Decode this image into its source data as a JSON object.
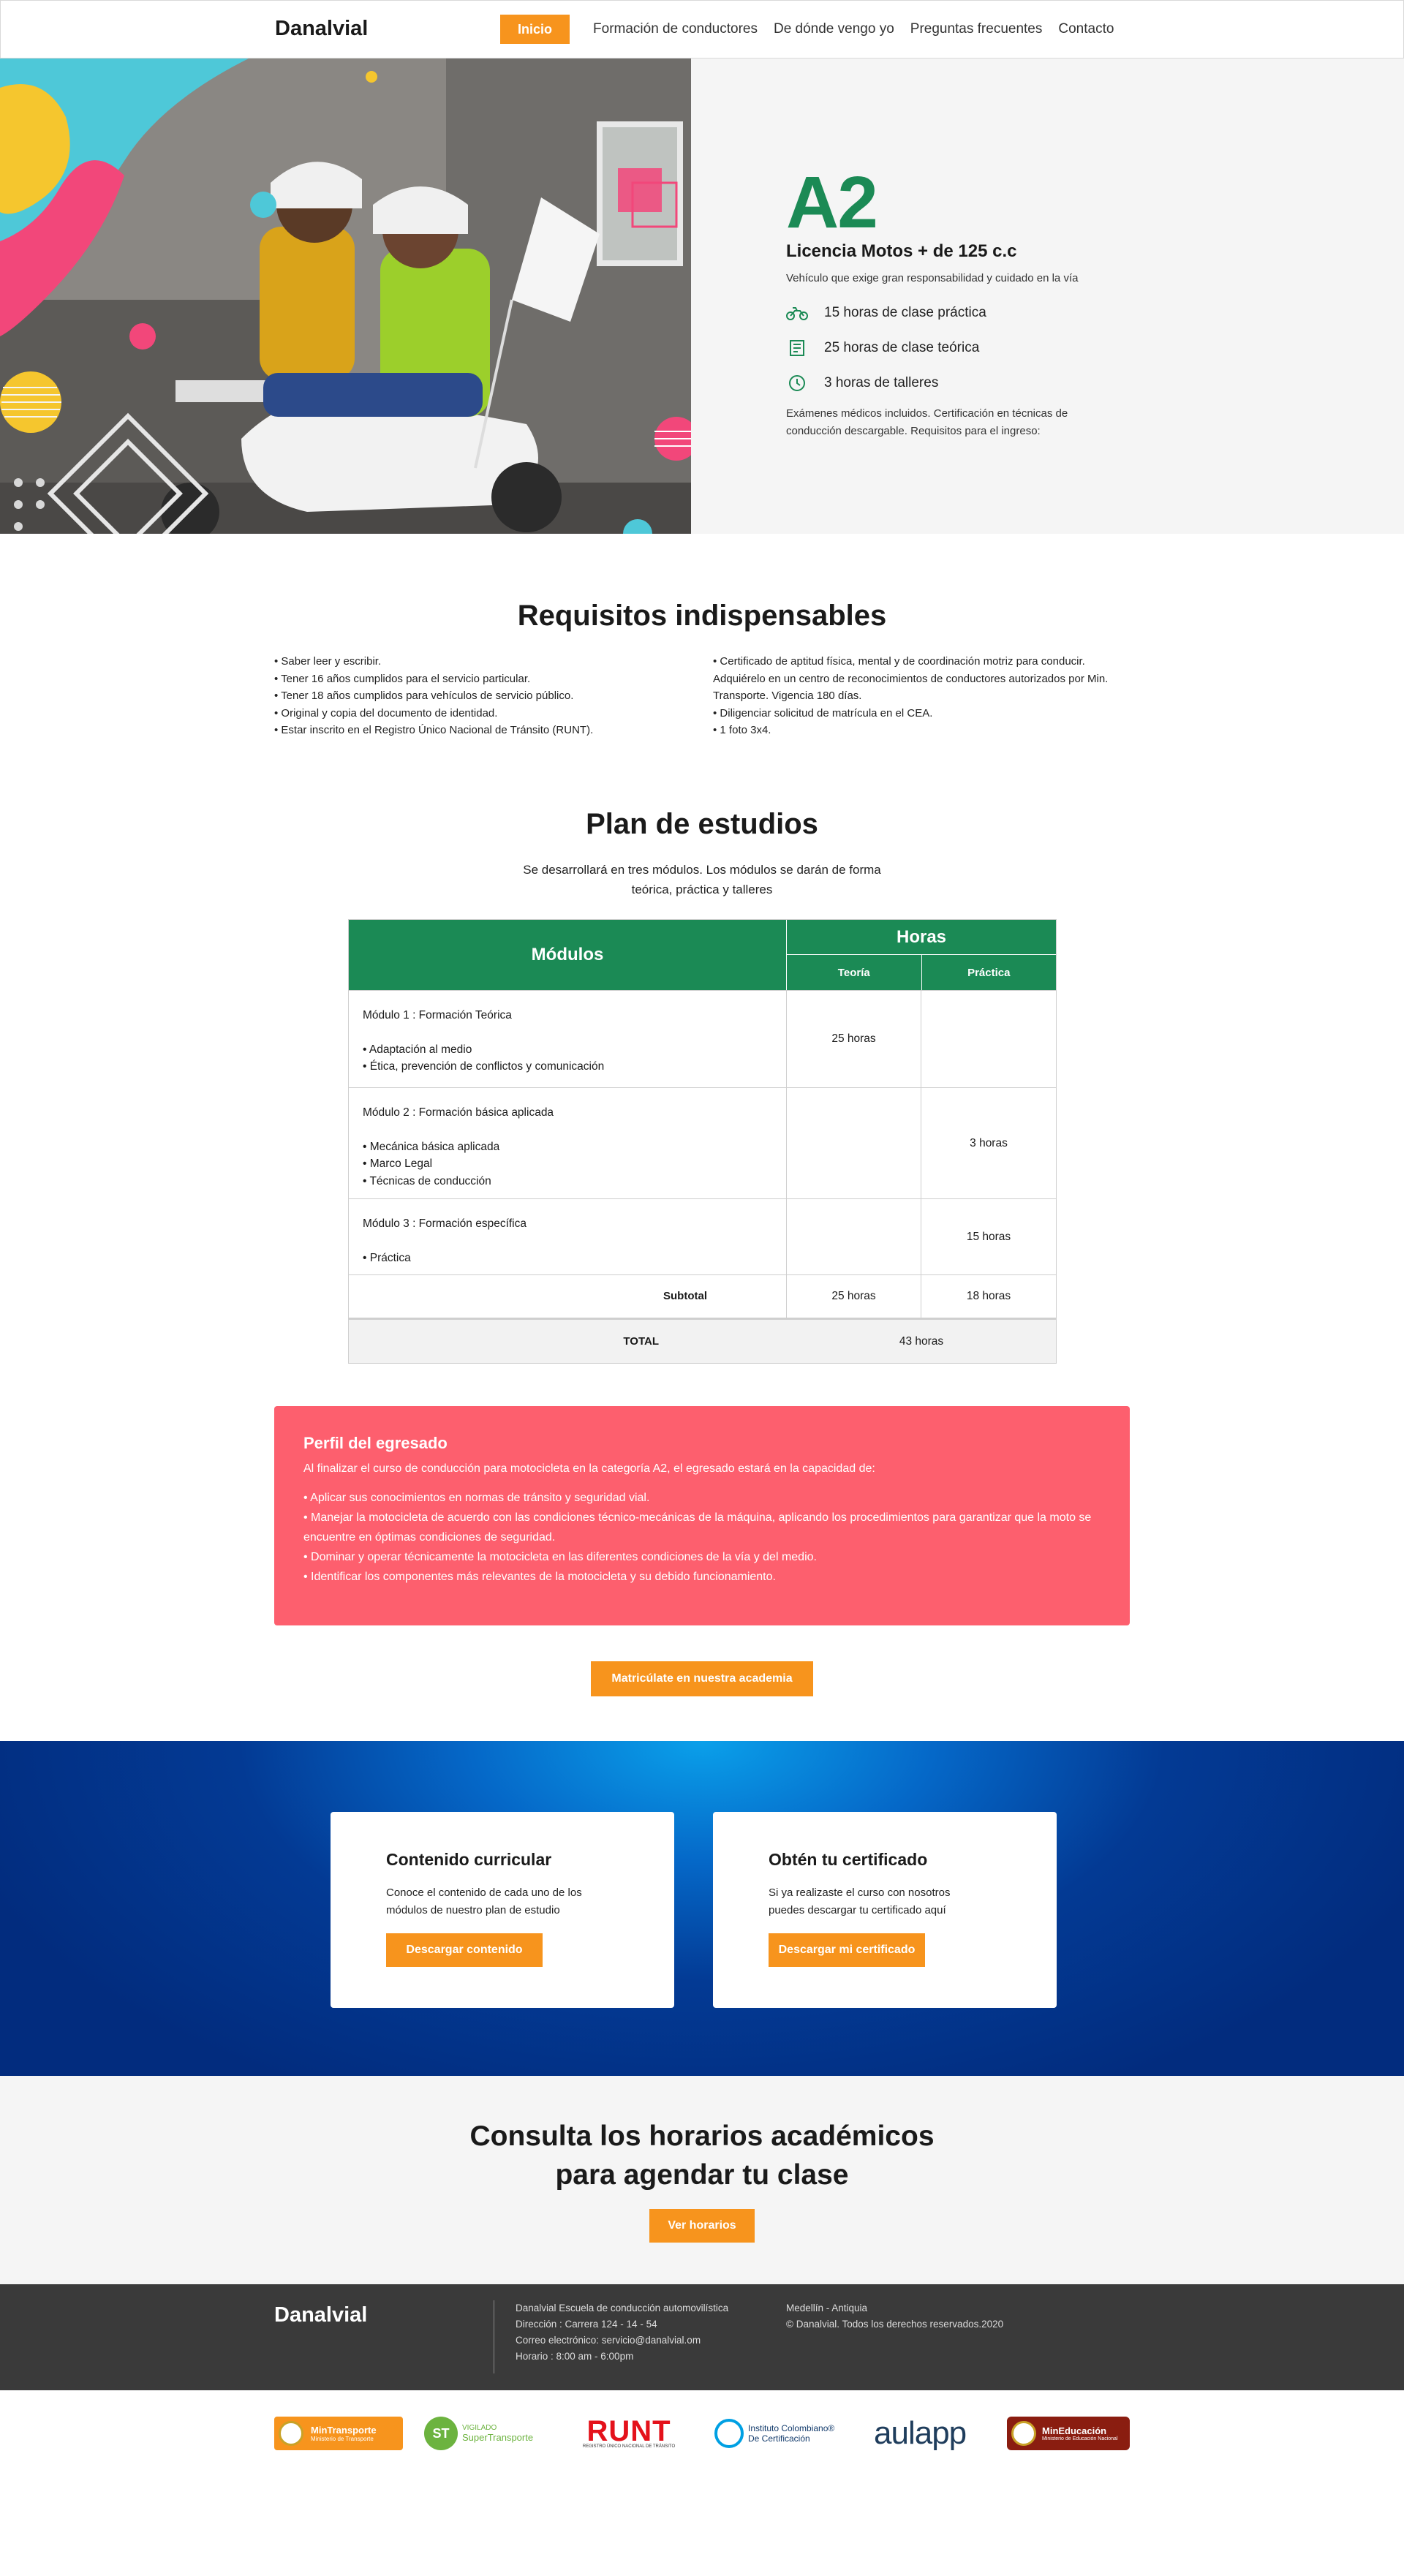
{
  "nav": {
    "brand": "Danalvial",
    "active": "Inicio",
    "links": [
      "Formación de conductores",
      "De dónde vengo yo",
      "Preguntas frecuentes",
      "Contacto"
    ]
  },
  "hero": {
    "category": "A2",
    "title": "Licencia Motos + de 125 c.c",
    "subtitle": "Vehículo que exige gran responsabilidad y cuidado en la vía",
    "features": [
      {
        "icon": "motorcycle-icon",
        "text": "15 horas de clase práctica"
      },
      {
        "icon": "book-icon",
        "text": "25 horas de clase teórica"
      },
      {
        "icon": "clock-icon",
        "text": "3 horas de talleres"
      }
    ],
    "description": "Exámenes médicos incluidos. Certificación en técnicas de conducción descargable. Requisitos para el ingreso:"
  },
  "requirements": {
    "title": "Requisitos indispensables",
    "left": [
      "•  Saber leer y escribir.",
      "• Tener 16 años cumplidos para el servicio particular.",
      "• Tener 18 años cumplidos para vehículos de servicio público.",
      "•  Original y copia del documento de identidad.",
      "•  Estar inscrito en el Registro Único Nacional de Tránsito (RUNT)."
    ],
    "right": [
      "•  Certificado de aptitud física, mental y de coordinación motriz para conducir. Adquiérelo en un centro de reconocimientos de conductores autorizados por Min. Transporte. Vigencia 180 días.",
      "•  Diligenciar solicitud de matrícula en el CEA.",
      "•  1 foto 3x4."
    ]
  },
  "plan": {
    "title": "Plan de estudios",
    "subtitle": "Se desarrollará en tres módulos. Los módulos se darán de forma teórica, práctica y talleres",
    "head_modules": "Módulos",
    "head_hours": "Horas",
    "head_theory": "Teoría",
    "head_practice": "Práctica",
    "rows": [
      {
        "module": "Módulo 1 : Formación Teórica",
        "items": [
          "•  Adaptación al medio",
          "•  Ética, prevención de conflictos y comunicación"
        ],
        "theory": "25 horas",
        "practice": ""
      },
      {
        "module": "Módulo 2 : Formación básica aplicada",
        "items": [
          "•  Mecánica básica aplicada",
          "•  Marco Legal",
          "•  Técnicas de conducción"
        ],
        "theory": "",
        "practice": "3 horas"
      },
      {
        "module": "Módulo 3 : Formación específica",
        "items": [
          "•  Práctica"
        ],
        "theory": "",
        "practice": "15 horas"
      }
    ],
    "subtotal_label": "Subtotal",
    "subtotal_theory": "25 horas",
    "subtotal_practice": "18 horas",
    "total_label": "TOTAL",
    "total_value": "43 horas"
  },
  "profile": {
    "title": "Perfil del egresado",
    "intro": "Al finalizar el curso de conducción para motocicleta en la categoría A2, el egresado estará en la capacidad de:",
    "items": [
      "•   Aplicar sus conocimientos en normas de tránsito y seguridad vial.",
      "•   Manejar la motocicleta de acuerdo con las condiciones técnico-mecánicas de la máquina, aplicando los procedimientos para garantizar que la moto se encuentre en óptimas condiciones de seguridad.",
      "•   Dominar y operar técnicamente la motocicleta en las diferentes condiciones de la vía y del medio.",
      "•   Identificar los componentes más relevantes de la motocicleta y su debido funcionamiento."
    ]
  },
  "enroll_label": "Matricúlate en nuestra academia",
  "cards": [
    {
      "title": "Contenido curricular",
      "text": "Conoce el contenido de cada uno de los módulos de nuestro plan de estudio",
      "button": "Descargar  contenido"
    },
    {
      "title": "Obtén tu certificado",
      "text": "Si ya realizaste el curso con nosotros puedes descargar tu certificado aquí",
      "button": "Descargar mi certificado"
    }
  ],
  "schedule": {
    "line1": "Consulta los horarios académicos",
    "line2": "para agendar tu clase",
    "button": "Ver horarios"
  },
  "footer": {
    "brand": "Danalvial",
    "info": [
      "Danalvial  Escuela de conducción automovilística",
      "Dirección : Carrera 124 - 14 - 54",
      "Correo electrónico: servicio@danalvial.om",
      "Horario : 8:00 am - 6:00pm"
    ],
    "location": [
      "Medellín - Antiquia",
      "© Danalvial. Todos los derechos reservados.2020"
    ]
  },
  "logos": {
    "mintransporte": "MinTransporte",
    "mintransporte_sub": "Ministerio de Transporte",
    "st": "ST",
    "vigilado": "VIGILADO",
    "supertransporte": "SuperTransporte",
    "runt": "RUNT",
    "runt_sub": "REGISTRO ÚNICO NACIONAL DE TRÁNSITO",
    "icc_line1": "Instituto Colombiano®",
    "icc_line2": "De Certificación",
    "aulapp": "aulapp",
    "mineducacion": "MinEducación",
    "mineducacion_sub": "Ministerio de Educación Nacional"
  },
  "colors": {
    "accent": "#f7941d",
    "green": "#1b8a55",
    "coral": "#fd5f6e",
    "blue": "#033a94",
    "footer": "#3a3a3a"
  }
}
